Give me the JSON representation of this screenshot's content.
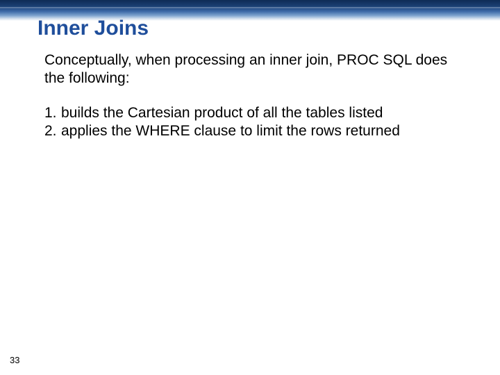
{
  "slide": {
    "title": "Inner Joins",
    "intro": "Conceptually, when processing an inner join, PROC SQL does the following:",
    "items": [
      {
        "num": "1.",
        "text": "builds the Cartesian product of all the tables listed"
      },
      {
        "num": "2.",
        "text": "applies the WHERE clause to limit the rows returned"
      }
    ],
    "page_number": "33"
  }
}
